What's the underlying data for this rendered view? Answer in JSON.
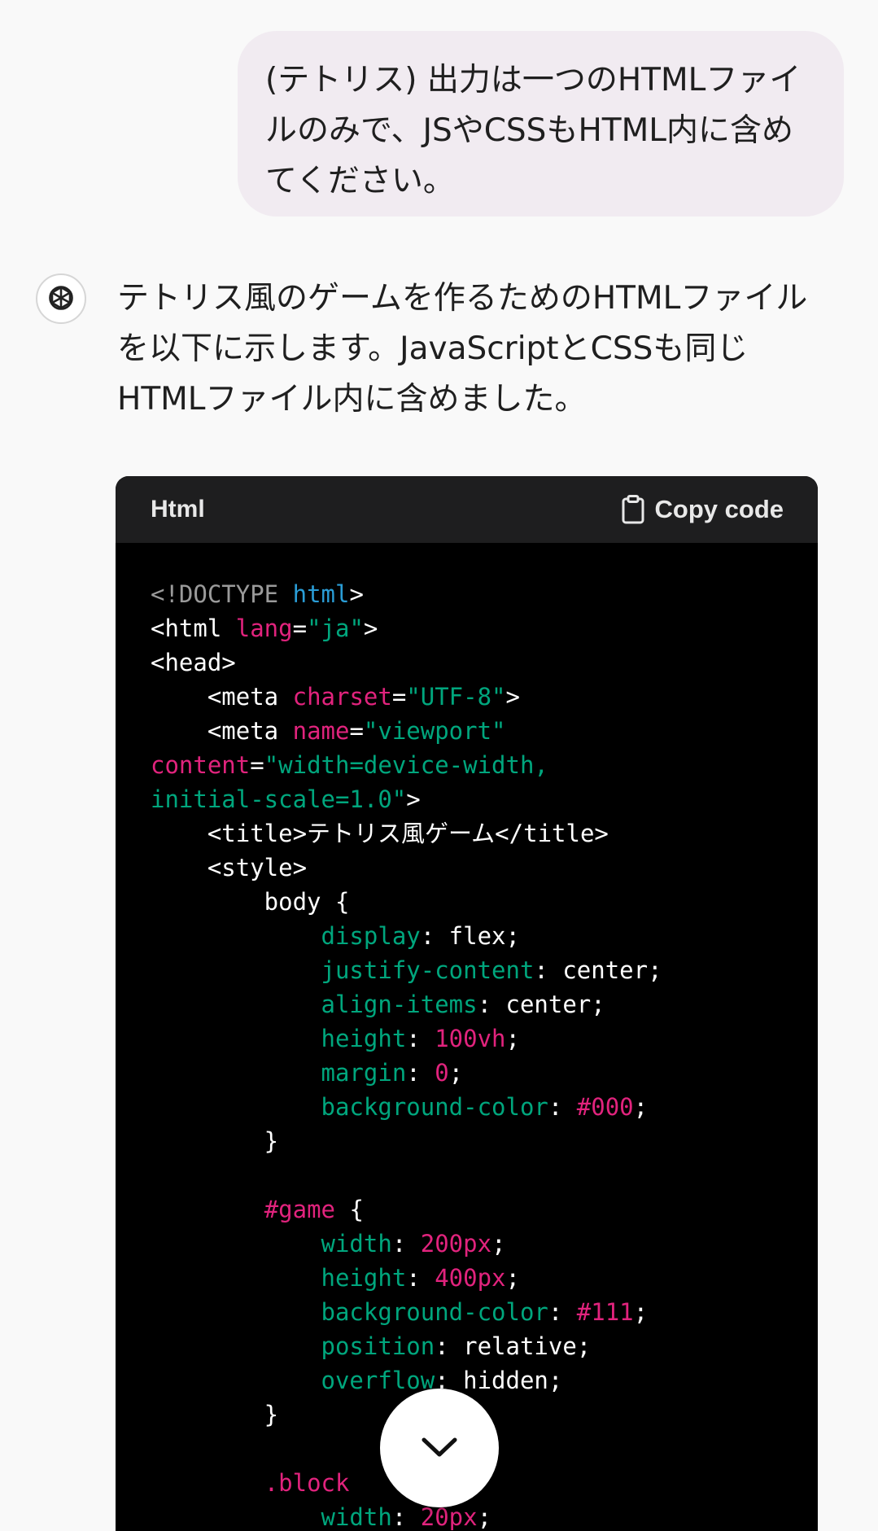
{
  "user_message": {
    "text": "(テトリス) 出力は一つのHTMLファイルのみで、JSやCSSもHTML内に含めてください。"
  },
  "assistant": {
    "avatar_icon": "openai-logo-icon",
    "message": "テトリス風のゲームを作るためのHTMLファイルを以下に示します。JavaScriptとCSSも同じHTMLファイル内に含めました。"
  },
  "code_block": {
    "language": "Html",
    "copy_label": "Copy code",
    "copy_icon": "clipboard-icon",
    "lines": [
      [
        {
          "t": "<!DOCTYPE ",
          "c": "muted"
        },
        {
          "t": "html",
          "c": "blue"
        },
        {
          "t": ">",
          "c": "plain"
        }
      ],
      [
        {
          "t": "<html ",
          "c": "plain"
        },
        {
          "t": "lang",
          "c": "pink"
        },
        {
          "t": "=",
          "c": "plain"
        },
        {
          "t": "\"ja\"",
          "c": "green"
        },
        {
          "t": ">",
          "c": "plain"
        }
      ],
      [
        {
          "t": "<head>",
          "c": "plain"
        }
      ],
      [
        {
          "t": "    <meta ",
          "c": "plain"
        },
        {
          "t": "charset",
          "c": "pink"
        },
        {
          "t": "=",
          "c": "plain"
        },
        {
          "t": "\"UTF-8\"",
          "c": "green"
        },
        {
          "t": ">",
          "c": "plain"
        }
      ],
      [
        {
          "t": "    <meta ",
          "c": "plain"
        },
        {
          "t": "name",
          "c": "pink"
        },
        {
          "t": "=",
          "c": "plain"
        },
        {
          "t": "\"viewport\"",
          "c": "green"
        }
      ],
      [
        {
          "t": "content",
          "c": "pink"
        },
        {
          "t": "=",
          "c": "plain"
        },
        {
          "t": "\"width=device-width,",
          "c": "green"
        }
      ],
      [
        {
          "t": "initial-scale=1.0\"",
          "c": "green"
        },
        {
          "t": ">",
          "c": "plain"
        }
      ],
      [
        {
          "t": "    <title>テトリス風ゲーム</title>",
          "c": "plain"
        }
      ],
      [
        {
          "t": "    <style>",
          "c": "plain"
        }
      ],
      [
        {
          "t": "        body {",
          "c": "plain"
        }
      ],
      [
        {
          "t": "            ",
          "c": "plain"
        },
        {
          "t": "display",
          "c": "green"
        },
        {
          "t": ": flex;",
          "c": "plain"
        }
      ],
      [
        {
          "t": "            ",
          "c": "plain"
        },
        {
          "t": "justify-content",
          "c": "green"
        },
        {
          "t": ": center;",
          "c": "plain"
        }
      ],
      [
        {
          "t": "            ",
          "c": "plain"
        },
        {
          "t": "align-items",
          "c": "green"
        },
        {
          "t": ": center;",
          "c": "plain"
        }
      ],
      [
        {
          "t": "            ",
          "c": "plain"
        },
        {
          "t": "height",
          "c": "green"
        },
        {
          "t": ": ",
          "c": "plain"
        },
        {
          "t": "100vh",
          "c": "pink"
        },
        {
          "t": ";",
          "c": "plain"
        }
      ],
      [
        {
          "t": "            ",
          "c": "plain"
        },
        {
          "t": "margin",
          "c": "green"
        },
        {
          "t": ": ",
          "c": "plain"
        },
        {
          "t": "0",
          "c": "pink"
        },
        {
          "t": ";",
          "c": "plain"
        }
      ],
      [
        {
          "t": "            ",
          "c": "plain"
        },
        {
          "t": "background-color",
          "c": "green"
        },
        {
          "t": ": ",
          "c": "plain"
        },
        {
          "t": "#000",
          "c": "pink"
        },
        {
          "t": ";",
          "c": "plain"
        }
      ],
      [
        {
          "t": "        }",
          "c": "plain"
        }
      ],
      [
        {
          "t": "",
          "c": "plain"
        }
      ],
      [
        {
          "t": "        ",
          "c": "plain"
        },
        {
          "t": "#game",
          "c": "pink"
        },
        {
          "t": " {",
          "c": "plain"
        }
      ],
      [
        {
          "t": "            ",
          "c": "plain"
        },
        {
          "t": "width",
          "c": "green"
        },
        {
          "t": ": ",
          "c": "plain"
        },
        {
          "t": "200px",
          "c": "pink"
        },
        {
          "t": ";",
          "c": "plain"
        }
      ],
      [
        {
          "t": "            ",
          "c": "plain"
        },
        {
          "t": "height",
          "c": "green"
        },
        {
          "t": ": ",
          "c": "plain"
        },
        {
          "t": "400px",
          "c": "pink"
        },
        {
          "t": ";",
          "c": "plain"
        }
      ],
      [
        {
          "t": "            ",
          "c": "plain"
        },
        {
          "t": "background-color",
          "c": "green"
        },
        {
          "t": ": ",
          "c": "plain"
        },
        {
          "t": "#111",
          "c": "pink"
        },
        {
          "t": ";",
          "c": "plain"
        }
      ],
      [
        {
          "t": "            ",
          "c": "plain"
        },
        {
          "t": "position",
          "c": "green"
        },
        {
          "t": ": relative;",
          "c": "plain"
        }
      ],
      [
        {
          "t": "            ",
          "c": "plain"
        },
        {
          "t": "overflow",
          "c": "green"
        },
        {
          "t": ": hidden;",
          "c": "plain"
        }
      ],
      [
        {
          "t": "        }",
          "c": "plain"
        }
      ],
      [
        {
          "t": "",
          "c": "plain"
        }
      ],
      [
        {
          "t": "        ",
          "c": "plain"
        },
        {
          "t": ".block",
          "c": "pink"
        }
      ],
      [
        {
          "t": "            ",
          "c": "plain"
        },
        {
          "t": "width",
          "c": "green"
        },
        {
          "t": ": ",
          "c": "plain"
        },
        {
          "t": "20px",
          "c": "pink"
        },
        {
          "t": ";",
          "c": "plain"
        }
      ]
    ]
  },
  "scroll_button": {
    "icon": "chevron-down-icon"
  }
}
